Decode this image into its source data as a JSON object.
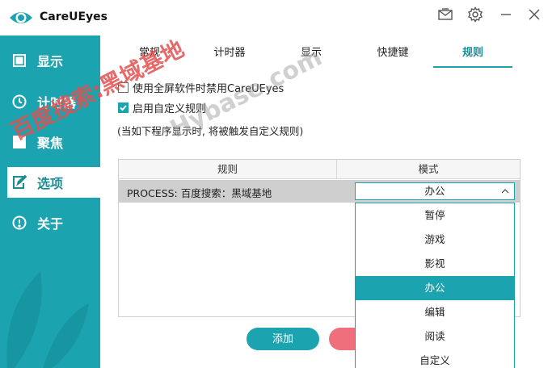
{
  "app": {
    "title": "CareUEyes"
  },
  "titlebar": {
    "icons": [
      "mail-icon",
      "gear-icon",
      "minimize-icon",
      "close-icon"
    ]
  },
  "sidebar": {
    "items": [
      {
        "label": "显示",
        "icon": "display-icon"
      },
      {
        "label": "计时器",
        "icon": "clock-icon"
      },
      {
        "label": "聚焦",
        "icon": "focus-icon"
      },
      {
        "label": "选项",
        "icon": "options-icon",
        "active": true
      },
      {
        "label": "关于",
        "icon": "info-icon"
      }
    ]
  },
  "tabs": [
    {
      "label": "常规"
    },
    {
      "label": "计时器"
    },
    {
      "label": "显示"
    },
    {
      "label": "快捷键"
    },
    {
      "label": "规则",
      "active": true
    }
  ],
  "options": {
    "fullscreen_label": "使用全屏软件时禁用CareUEyes",
    "fullscreen_checked": false,
    "custom_rules_label": "启用自定义规则",
    "custom_rules_checked": true,
    "hint": "(当如下程序显示时, 将被触发自定义规则)"
  },
  "table": {
    "headers": [
      "规则",
      "模式"
    ],
    "rows": [
      {
        "rule": "PROCESS: 百度搜索：黑域基地",
        "mode": "办公"
      }
    ]
  },
  "dropdown": {
    "options": [
      "暂停",
      "游戏",
      "影视",
      "办公",
      "编辑",
      "阅读",
      "自定义"
    ],
    "selected": "办公"
  },
  "buttons": {
    "add": "添加"
  },
  "watermark": {
    "line1": "百度搜索:黑域基地",
    "line2": "Hybase.com"
  },
  "colors": {
    "accent": "#1ba3b0",
    "delete": "#ef6f7d"
  }
}
